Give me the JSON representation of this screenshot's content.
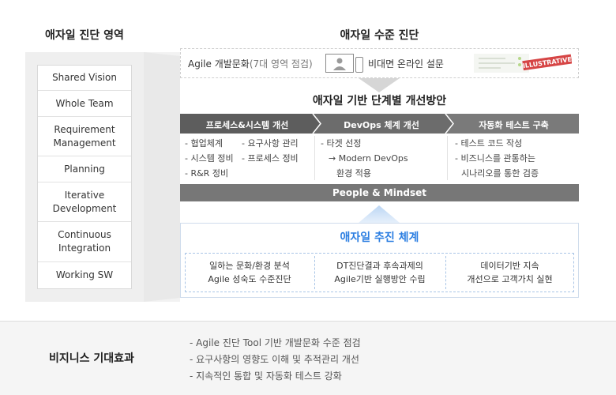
{
  "left": {
    "title": "애자일 진단 영역",
    "items": [
      "Shared Vision",
      "Whole Team",
      "Requirement\nManagement",
      "Planning",
      "Iterative\nDevelopment",
      "Continuous\nIntegration",
      "Working SW"
    ]
  },
  "assessment": {
    "title": "애자일 수준 진단",
    "agile_label": "Agile 개발문화",
    "agile_sub": "(7대 영역 점검)",
    "online_label": "비대면 온라인 설문",
    "illustrative_tag": "ILLUSTRATIVE"
  },
  "improvement": {
    "title": "애자일 기반 단계별 개선방안",
    "columns": [
      {
        "header": "프로세스&시스템 개선",
        "left_items": [
          "- 협업체계",
          "- 시스템 정비",
          "- R&R 정비"
        ],
        "right_items": [
          "- 요구사항 관리",
          "- 프로세스 정비"
        ]
      },
      {
        "header": "DevOps 체계 개선",
        "lines": [
          "- 타겟 선정",
          "→ Modern DevOps",
          "환경 적용"
        ]
      },
      {
        "header": "자동화 테스트 구축",
        "lines": [
          "- 테스트 코드 작성",
          "- 비즈니스를 관통하는",
          "시나리오를 통한 검증"
        ]
      }
    ],
    "people_bar": "People & Mindset"
  },
  "promotion": {
    "title": "애자일 추진 체계",
    "cells": [
      [
        "일하는 문화/환경 분석",
        "Agile 성숙도 수준진단"
      ],
      [
        "DT진단결과 후속과제의",
        "Agile기반 실행방안 수립"
      ],
      [
        "데이터기반 지속",
        "개선으로 고객가치 실현"
      ]
    ]
  },
  "business": {
    "title": "비지니스 기대효과",
    "effects": [
      "- Agile 진단 Tool 기반 개발문화 수준 점검",
      "- 요구사항의 영향도 이해 및 추적관리 개선",
      "- 지속적인 통합 및 자동화 테스트 강화"
    ]
  },
  "colors": {
    "chevron_dark": "#5d5d5d",
    "chevron_light": "#7a7a7a",
    "people_bar": "#777777",
    "accent_blue": "#2a7de1",
    "tag_red": "#d64545"
  }
}
